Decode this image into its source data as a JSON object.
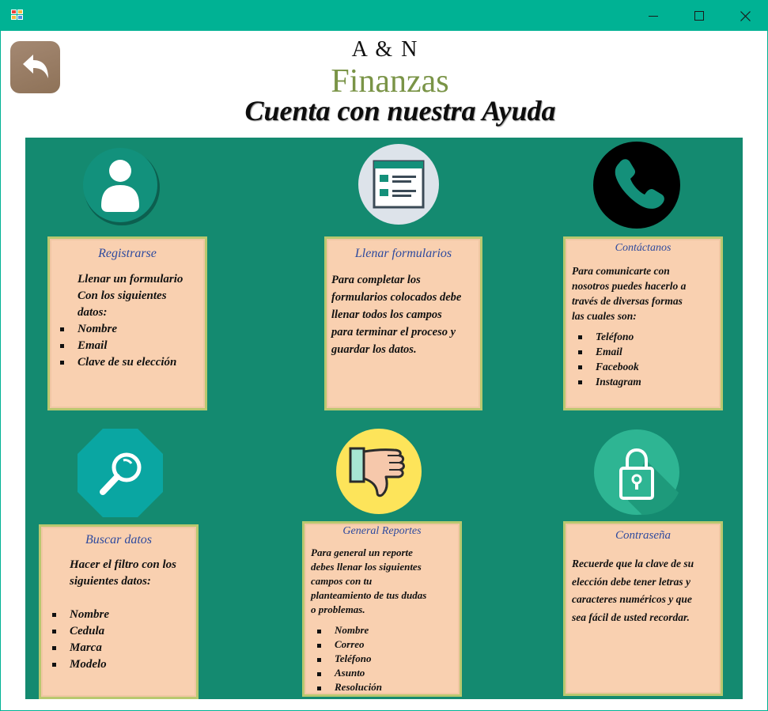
{
  "window": {
    "titlebar_color": "#00b294",
    "icon": "app-icon",
    "controls": [
      "minimize-icon",
      "maximize-icon",
      "close-icon"
    ]
  },
  "back_button": {
    "icon": "back-arrow-icon"
  },
  "header": {
    "brand_top": "A & N",
    "brand_name": "Finanzas",
    "subtitle": "Cuenta con nuestra Ayuda"
  },
  "colors": {
    "panel": "#148a70",
    "card_bg": "#f9d0b0",
    "card_border": "#b9c86f",
    "card_title": "#2e4a9e",
    "brand_green": "#7a9447"
  },
  "cards": [
    {
      "icon": "user-icon",
      "title": "Registrarse",
      "intro": [
        "Llenar un formulario",
        "Con los siguientes",
        "datos:"
      ],
      "items": [
        "Nombre",
        "Email",
        "Clave de su elección"
      ]
    },
    {
      "icon": "form-icon",
      "title": "Llenar formularios",
      "intro": [
        "Para completar los",
        "formularios colocados debe",
        "llenar todos los campos",
        "para terminar el proceso y",
        "guardar los datos."
      ],
      "items": []
    },
    {
      "icon": "phone-icon",
      "title": "Contáctanos",
      "intro": [
        "Para comunicarte con",
        "nosotros puedes hacerlo a",
        "través de diversas formas",
        "las cuales son:"
      ],
      "items": [
        "Teléfono",
        "Email",
        "Facebook",
        "Instagram"
      ]
    },
    {
      "icon": "search-icon",
      "title": "Buscar datos",
      "intro": [
        "Hacer el filtro con los",
        "siguientes datos:"
      ],
      "items": [
        "Nombre",
        "Cedula",
        "Marca",
        "Modelo"
      ]
    },
    {
      "icon": "thumbs-down-icon",
      "title": "General Reportes",
      "intro": [
        "Para general un reporte",
        "debes llenar los siguientes",
        "campos con tu",
        "planteamiento de tus dudas",
        "o problemas."
      ],
      "items": [
        "Nombre",
        "Correo",
        "Teléfono",
        "Asunto",
        "Resolución"
      ]
    },
    {
      "icon": "lock-icon",
      "title": "Contraseña",
      "intro": [
        "Recuerde que la clave de su",
        "elección debe tener letras y",
        "caracteres numéricos y que",
        "sea fácil de usted recordar."
      ],
      "items": []
    }
  ]
}
